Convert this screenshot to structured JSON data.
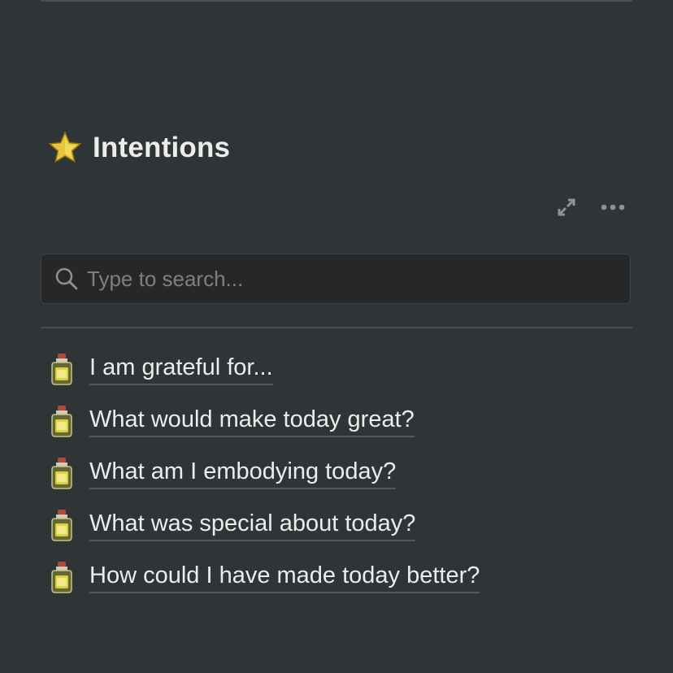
{
  "section": {
    "icon": "star-icon",
    "title": "Intentions"
  },
  "toolbar": {
    "expand_icon": "expand-icon",
    "more_icon": "more-icon"
  },
  "search": {
    "placeholder": "Type to search...",
    "value": ""
  },
  "pages": [
    {
      "icon": "jar-icon",
      "label": "I am grateful for..."
    },
    {
      "icon": "jar-icon",
      "label": "What would make today great?"
    },
    {
      "icon": "jar-icon",
      "label": "What am I embodying today?"
    },
    {
      "icon": "jar-icon",
      "label": "What was special about today?"
    },
    {
      "icon": "jar-icon",
      "label": "How could I have made today better?"
    }
  ],
  "colors": {
    "background": "#2f3437",
    "search_background": "#252729",
    "text": "#ececec",
    "placeholder": "#7d7f81",
    "divider": "#4a4f52",
    "underline": "#54585b"
  }
}
